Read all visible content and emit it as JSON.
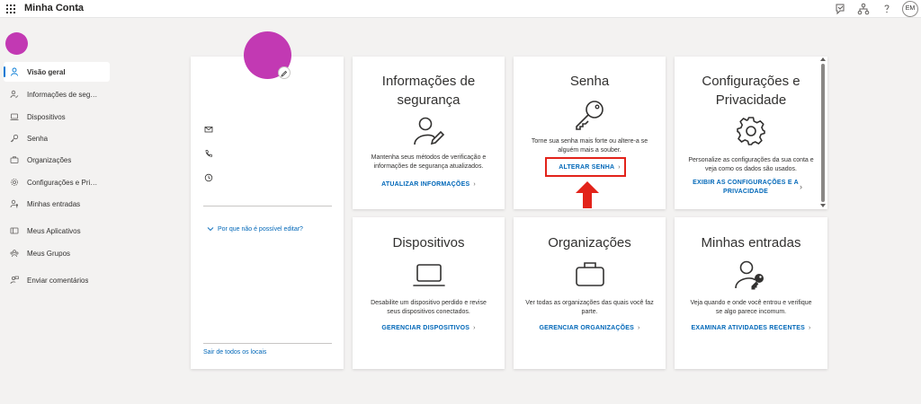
{
  "header": {
    "app_title": "Minha Conta",
    "user_initials": "EM"
  },
  "sidebar": {
    "items": [
      {
        "label": "Visão geral",
        "icon": "person-icon",
        "active": true
      },
      {
        "label": "Informações de segura...",
        "icon": "security-info-icon"
      },
      {
        "label": "Dispositivos",
        "icon": "laptop-icon"
      },
      {
        "label": "Senha",
        "icon": "key-icon"
      },
      {
        "label": "Organizações",
        "icon": "briefcase-icon"
      },
      {
        "label": "Configurações e Privaci...",
        "icon": "gear-icon"
      },
      {
        "label": "Minhas entradas",
        "icon": "sign-ins-icon"
      },
      {
        "label": "Meus Aplicativos",
        "icon": "apps-icon"
      },
      {
        "label": "Meus Grupos",
        "icon": "groups-icon"
      },
      {
        "label": "Enviar comentários",
        "icon": "feedback-icon"
      }
    ]
  },
  "profile": {
    "why_cant_edit": "Por que não é possível editar?",
    "sign_out_everywhere": "Sair de todos os locais"
  },
  "cards": {
    "security": {
      "title_line1": "Informações de",
      "title_line2": "segurança",
      "desc_line1": "Mantenha seus métodos de verificação e",
      "desc_line2": "informações de segurança atualizados.",
      "link": "ATUALIZAR INFORMAÇÕES"
    },
    "password": {
      "title": "Senha",
      "desc_line1": "Torne sua senha mais forte ou altere-a se",
      "desc_line2": "alguém mais a souber.",
      "link": "ALTERAR SENHA"
    },
    "settings": {
      "title_line1": "Configurações e",
      "title_line2": "Privacidade",
      "desc_line1": "Personalize as configurações da sua conta e",
      "desc_line2": "veja como os dados são usados.",
      "link_line1": "EXIBIR AS CONFIGURAÇÕES E A",
      "link_line2": "PRIVACIDADE"
    },
    "devices": {
      "title": "Dispositivos",
      "desc_line1": "Desabilite um dispositivo perdido e revise",
      "desc_line2": "seus dispositivos conectados.",
      "link": "GERENCIAR DISPOSITIVOS"
    },
    "organizations": {
      "title": "Organizações",
      "desc_line1": "Ver todas as organizações das quais você faz",
      "desc_line2": "parte.",
      "link": "GERENCIAR ORGANIZAÇÕES"
    },
    "signins": {
      "title": "Minhas entradas",
      "desc_line1": "Veja quando e onde você entrou e verifique",
      "desc_line2": "se algo parece incomum.",
      "link": "EXAMINAR ATIVIDADES RECENTES"
    }
  },
  "colors": {
    "accent": "#0067b8",
    "avatar": "#c239b3",
    "highlight": "#e2231a",
    "background": "#f3f2f1"
  }
}
